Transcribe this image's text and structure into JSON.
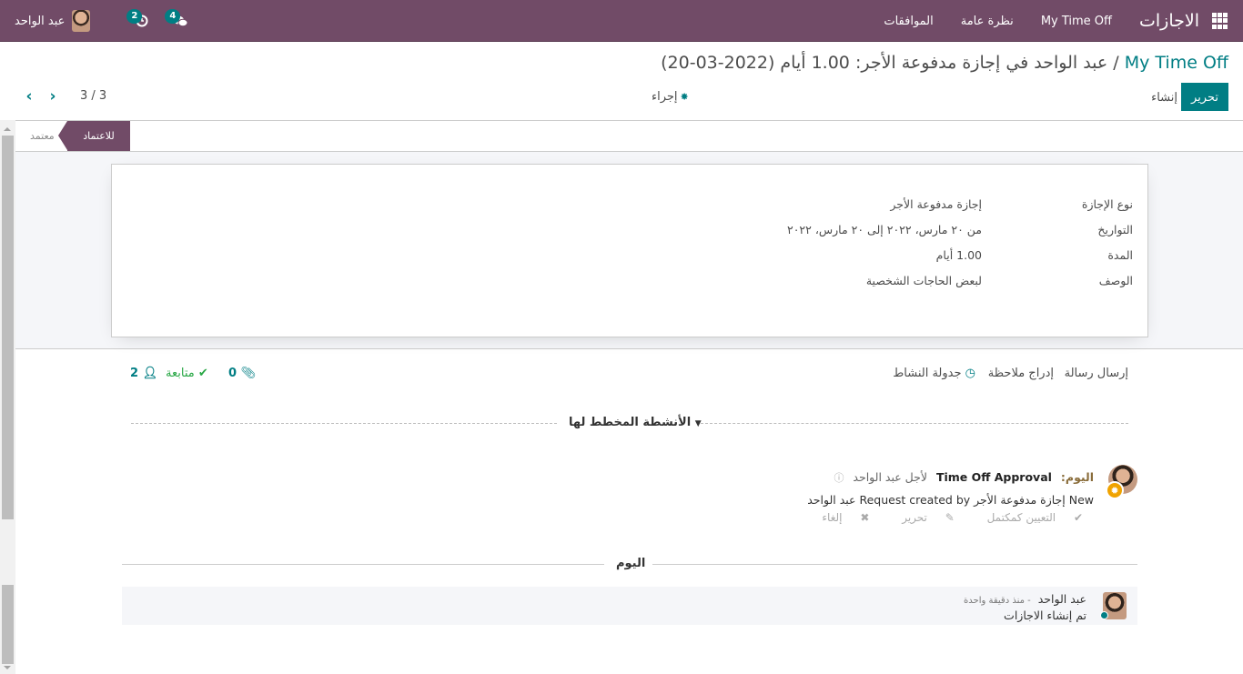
{
  "navbar": {
    "app_title": "الاجازات",
    "menu": [
      "My Time Off",
      "نظرة عامة",
      "الموافقات"
    ],
    "user_name": "عبد الواحد",
    "messages_count": "4",
    "activities_count": "2",
    "brand_color": "#714b67"
  },
  "control_panel": {
    "breadcrumb_link": "My Time Off",
    "breadcrumb_separator": " / ",
    "breadcrumb_current": "عبد الواحد في إجازة مدفوعة الأجر: 1.00 أيام (2022-03-20)",
    "edit_label": "تحرير",
    "create_label": "إنشاء",
    "action_label": "إجراء",
    "pager_value": "3 / 3",
    "accent_color": "#017e84"
  },
  "statusbar": {
    "active": "للاعتماد",
    "inactive": "معتمد"
  },
  "form": {
    "fields": [
      {
        "label": "نوع الإجازة",
        "value": "إجازة مدفوعة الأجر"
      },
      {
        "label": "التواريخ",
        "value": "من ٢٠ مارس، ٢٠٢٢ إلى ٢٠ مارس، ٢٠٢٢"
      },
      {
        "label": "المدة",
        "value": "1.00 أيام"
      },
      {
        "label": "الوصف",
        "value": "لبعض الحاجات الشخصية"
      }
    ]
  },
  "chatter": {
    "send_message": "إرسال رسالة",
    "log_note": "إدراج ملاحظة",
    "schedule_activity": "جدولة النشاط",
    "attachments_count": "0",
    "follow_label": "متابعة",
    "followers_count": "2",
    "planned_activities_title": "الأنشطة المخطط لها",
    "activity": {
      "when": "اليوم:",
      "title": "Time Off Approval",
      "for": "لأجل عبد الواحد",
      "summary": "New إجازة مدفوعة الأجر Request created by عبد الواحد",
      "mark_done": "التعيين كمكتمل",
      "edit": "تحرير",
      "cancel": "إلغاء"
    },
    "today_separator": "اليوم",
    "message": {
      "author": "عبد الواحد",
      "date": "- منذ دقيقة واحدة",
      "body": "تم إنشاء الاجازات"
    }
  }
}
